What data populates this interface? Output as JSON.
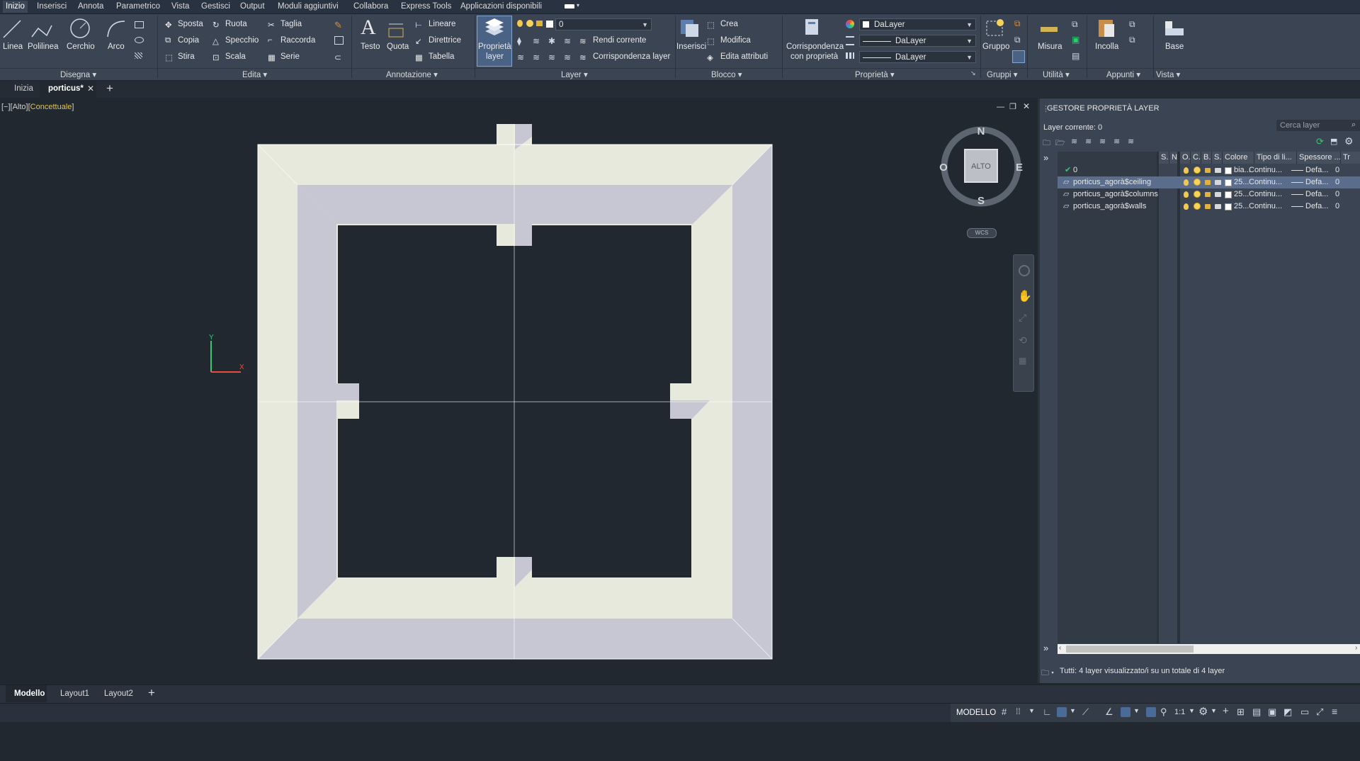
{
  "menubar": {
    "tabs": [
      "Inizio",
      "Inserisci",
      "Annota",
      "Parametrico",
      "Vista",
      "Gestisci",
      "Output",
      "Moduli aggiuntivi",
      "Collabora",
      "Express Tools",
      "Applicazioni disponibili"
    ],
    "active": "Inizio"
  },
  "ribbon": {
    "draw": {
      "linea": "Linea",
      "polilinea": "Polilinea",
      "cerchio": "Cerchio",
      "arco": "Arco",
      "title": "Disegna"
    },
    "edit": {
      "sposta": "Sposta",
      "copia": "Copia",
      "stira": "Stira",
      "ruota": "Ruota",
      "specchio": "Specchio",
      "scala": "Scala",
      "taglia": "Taglia",
      "raccorda": "Raccorda",
      "serie": "Serie",
      "title": "Edita"
    },
    "annotation": {
      "testo": "Testo",
      "quota": "Quota",
      "lineare": "Lineare",
      "direttrice": "Direttrice",
      "tabella": "Tabella",
      "title": "Annotazione"
    },
    "layer": {
      "proprieta_1": "Proprietà",
      "proprieta_2": "layer",
      "current_layer": "0",
      "rendi_corrente": "Rendi corrente",
      "corrispondenza_layer": "Corrispondenza layer",
      "title": "Layer"
    },
    "block": {
      "inserisci": "Inserisci",
      "crea": "Crea",
      "modifica": "Modifica",
      "edita_attributi": "Edita attributi",
      "title": "Blocco"
    },
    "properties": {
      "corr_1": "Corrispondenza",
      "corr_2": "con proprietà",
      "color": "DaLayer",
      "linetype": "DaLayer",
      "lineweight": "DaLayer",
      "title": "Proprietà"
    },
    "groups": {
      "gruppo": "Gruppo",
      "title": "Gruppi"
    },
    "utility": {
      "misura": "Misura",
      "title": "Utilità"
    },
    "clipboard": {
      "incolla": "Incolla",
      "title": "Appunti"
    },
    "view": {
      "base": "Base",
      "title": "Vista"
    }
  },
  "doc_tabs": {
    "home": "Inizia",
    "active": "porticus*"
  },
  "viewport": {
    "label_prefix": "[−][Alto][",
    "label_style": "Concettuale",
    "label_suffix": "]",
    "compass": {
      "n": "N",
      "s": "S",
      "e": "E",
      "w": "O",
      "top": "ALTO",
      "wcs": "WCS"
    },
    "ucs": {
      "x": "X",
      "y": "Y"
    }
  },
  "layer_panel": {
    "title": "GESTORE PROPRIETÀ LAYER",
    "current": "Layer corrente: 0",
    "search_placeholder": "Cerca layer",
    "columns": [
      "S..",
      "Nome",
      "O..",
      "C..",
      "B..",
      "S..",
      "Colore",
      "Tipo di li...",
      "Spessore ...",
      "Tr"
    ],
    "layers": [
      {
        "name": "0",
        "color": "bia...",
        "linetype": "Continu...",
        "lineweight": "Defa...",
        "tr": "0",
        "current": true
      },
      {
        "name": "porticus_agorà$ceiling",
        "color": "25...",
        "linetype": "Continu...",
        "lineweight": "Defa...",
        "tr": "0",
        "selected": true
      },
      {
        "name": "porticus_agorà$columns",
        "color": "25...",
        "linetype": "Continu...",
        "lineweight": "Defa...",
        "tr": "0"
      },
      {
        "name": "porticus_agorà$walls",
        "color": "25...",
        "linetype": "Continu...",
        "lineweight": "Defa...",
        "tr": "0"
      }
    ],
    "footer": "Tutti: 4 layer visualizzato/i su un totale di 4 layer"
  },
  "layout_tabs": [
    "Modello",
    "Layout1",
    "Layout2"
  ],
  "status": {
    "model": "MODELLO",
    "scale": "1:1"
  },
  "colors": {
    "wall_light": "#e8e9dd",
    "wall_shade": "#c6c7d3",
    "background": "#212830",
    "ribbon": "#3a4453"
  }
}
